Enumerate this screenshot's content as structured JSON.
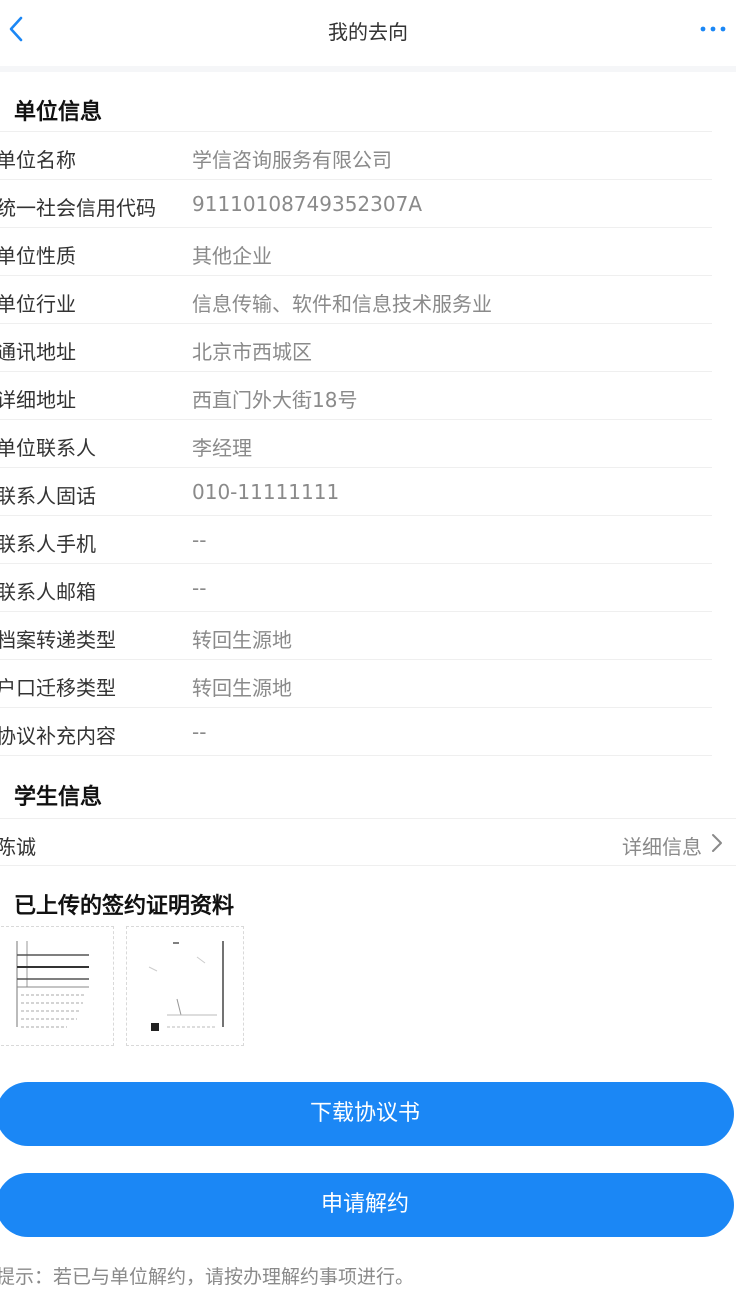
{
  "navbar": {
    "title": "我的去向",
    "back_icon": "chevron-left-icon",
    "more_icon": "more-dots-icon",
    "accent": "#1b87f5"
  },
  "unit_section": {
    "title": "单位信息",
    "rows": [
      {
        "label": "单位名称",
        "value": "学信咨询服务有限公司"
      },
      {
        "label": "统一社会信用代码",
        "value": "91110108749352307A"
      },
      {
        "label": "单位性质",
        "value": "其他企业"
      },
      {
        "label": "单位行业",
        "value": "信息传输、软件和信息技术服务业"
      },
      {
        "label": "通讯地址",
        "value": "北京市西城区"
      },
      {
        "label": "详细地址",
        "value": "西直门外大街18号"
      },
      {
        "label": "单位联系人",
        "value": "李经理"
      },
      {
        "label": "联系人固话",
        "value": "010-11111111"
      },
      {
        "label": "联系人手机",
        "value": "--"
      },
      {
        "label": "联系人邮箱",
        "value": "--"
      },
      {
        "label": "档案转递类型",
        "value": "转回生源地"
      },
      {
        "label": "户口迁移类型",
        "value": "转回生源地"
      },
      {
        "label": "协议补充内容",
        "value": "--"
      }
    ]
  },
  "student_section": {
    "title": "学生信息",
    "name": "陈诚",
    "detail_label": "详细信息"
  },
  "proof_section": {
    "title": "已上传的签约证明资料"
  },
  "buttons": {
    "download": "下载协议书",
    "terminate": "申请解约"
  },
  "tip": "提示：若已与单位解约，请按办理解约事项进行。"
}
